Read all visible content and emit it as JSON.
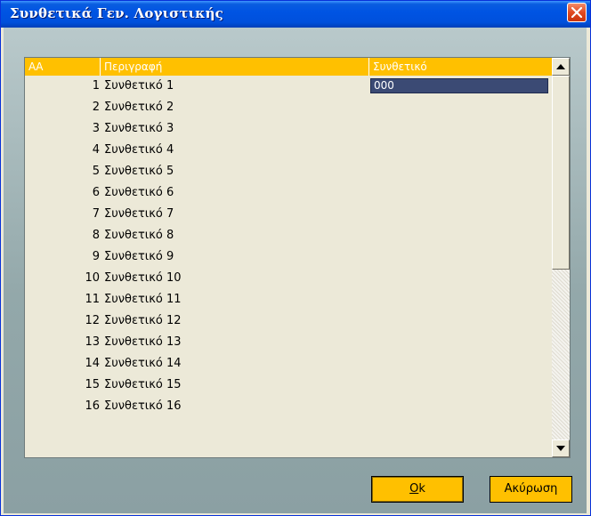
{
  "window": {
    "title": "Συνθετικά Γεν. Λογιστικής",
    "close_icon": "close-icon"
  },
  "grid": {
    "columns": [
      "ΑΑ",
      "Περιγραφή",
      "Συνθετικό"
    ],
    "rows": [
      {
        "aa": "1",
        "desc": "Συνθετικό 1",
        "code": "000"
      },
      {
        "aa": "2",
        "desc": "Συνθετικό 2",
        "code": ""
      },
      {
        "aa": "3",
        "desc": "Συνθετικό 3",
        "code": ""
      },
      {
        "aa": "4",
        "desc": "Συνθετικό 4",
        "code": ""
      },
      {
        "aa": "5",
        "desc": "Συνθετικό 5",
        "code": ""
      },
      {
        "aa": "6",
        "desc": "Συνθετικό 6",
        "code": ""
      },
      {
        "aa": "7",
        "desc": "Συνθετικό 7",
        "code": ""
      },
      {
        "aa": "8",
        "desc": "Συνθετικό 8",
        "code": ""
      },
      {
        "aa": "9",
        "desc": "Συνθετικό 9",
        "code": ""
      },
      {
        "aa": "10",
        "desc": "Συνθετικό 10",
        "code": ""
      },
      {
        "aa": "11",
        "desc": "Συνθετικό 11",
        "code": ""
      },
      {
        "aa": "12",
        "desc": "Συνθετικό 12",
        "code": ""
      },
      {
        "aa": "13",
        "desc": "Συνθετικό 13",
        "code": ""
      },
      {
        "aa": "14",
        "desc": "Συνθετικό 14",
        "code": ""
      },
      {
        "aa": "15",
        "desc": "Συνθετικό 15",
        "code": ""
      },
      {
        "aa": "16",
        "desc": "Συνθετικό 16",
        "code": ""
      }
    ]
  },
  "buttons": {
    "ok": {
      "mnemonic": "O",
      "rest": "k"
    },
    "cancel": {
      "mnemonic": "",
      "rest": "Ακύρωση"
    }
  },
  "colors": {
    "header": "#ffc000",
    "button": "#ffc000",
    "selected_cell": "#3b4a74",
    "title_bar": "#0054e3"
  }
}
